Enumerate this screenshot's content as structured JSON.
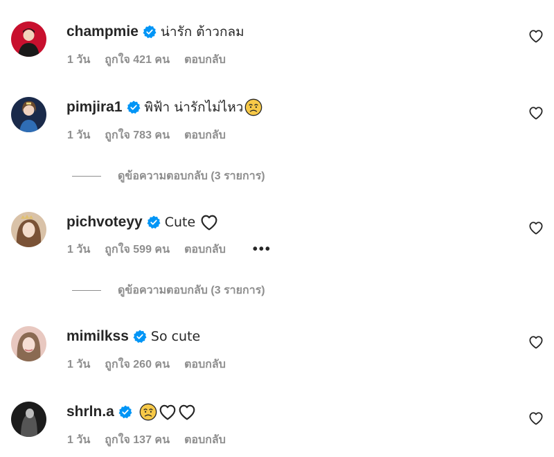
{
  "comments": [
    {
      "username": "champmie",
      "text": "น่ารัก ต้าวกลม",
      "time": "1 วัน",
      "likes": "ถูกใจ 421 คน",
      "reply_label": "ตอบกลับ",
      "avatar_bg": "#c8102e"
    },
    {
      "username": "pimjira1",
      "text": "พิฟ้า น่ารักไม่ไหว",
      "time": "1 วัน",
      "likes": "ถูกใจ 783 คน",
      "reply_label": "ตอบกลับ",
      "avatar_bg": "#1a2a4a",
      "view_replies": "ดูข้อความตอบกลับ (3 รายการ)"
    },
    {
      "username": "pichvoteyy",
      "text": "Cute",
      "time": "1 วัน",
      "likes": "ถูกใจ 599 คน",
      "reply_label": "ตอบกลับ",
      "more_label": "•••",
      "avatar_bg": "#d9c2a8",
      "view_replies": "ดูข้อความตอบกลับ (3 รายการ)"
    },
    {
      "username": "mimilkss",
      "text": "So cute",
      "time": "1 วัน",
      "likes": "ถูกใจ 260 คน",
      "reply_label": "ตอบกลับ",
      "avatar_bg": "#e8c8c0"
    },
    {
      "username": "shrln.a",
      "text": "",
      "time": "1 วัน",
      "likes": "ถูกใจ 137 คน",
      "reply_label": "ตอบกลับ",
      "avatar_bg": "#1c1c1c"
    }
  ],
  "colors": {
    "verified": "#0095f6",
    "muted": "#8e8e8e",
    "text": "#262626"
  },
  "icons": {
    "verified": "verified-badge-icon",
    "like": "heart-outline-icon",
    "emoji_sad": "sad-face-emoji",
    "emoji_heart": "white-heart-emoji"
  }
}
